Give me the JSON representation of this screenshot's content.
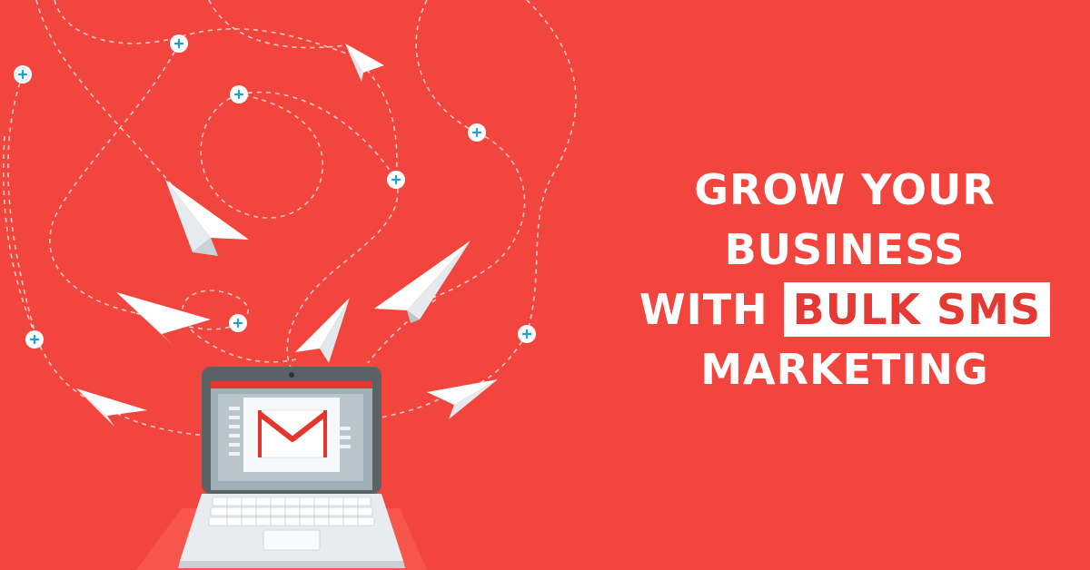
{
  "headline": {
    "line1": "GROW YOUR",
    "line2": "BUSINESS",
    "line3_prefix": "WITH",
    "line3_highlight": "BULK SMS",
    "line4": "MARKETING"
  },
  "colors": {
    "background": "#f2453d",
    "text": "#ffffff",
    "highlight_bg": "#ffffff",
    "highlight_text": "#e53a34",
    "laptop_body": "#5b6266",
    "laptop_base": "#e9ecee",
    "envelope_red": "#e4362f"
  },
  "icons": [
    "paper-plane-icon",
    "plus-marker-icon",
    "laptop-icon",
    "envelope-icon"
  ]
}
